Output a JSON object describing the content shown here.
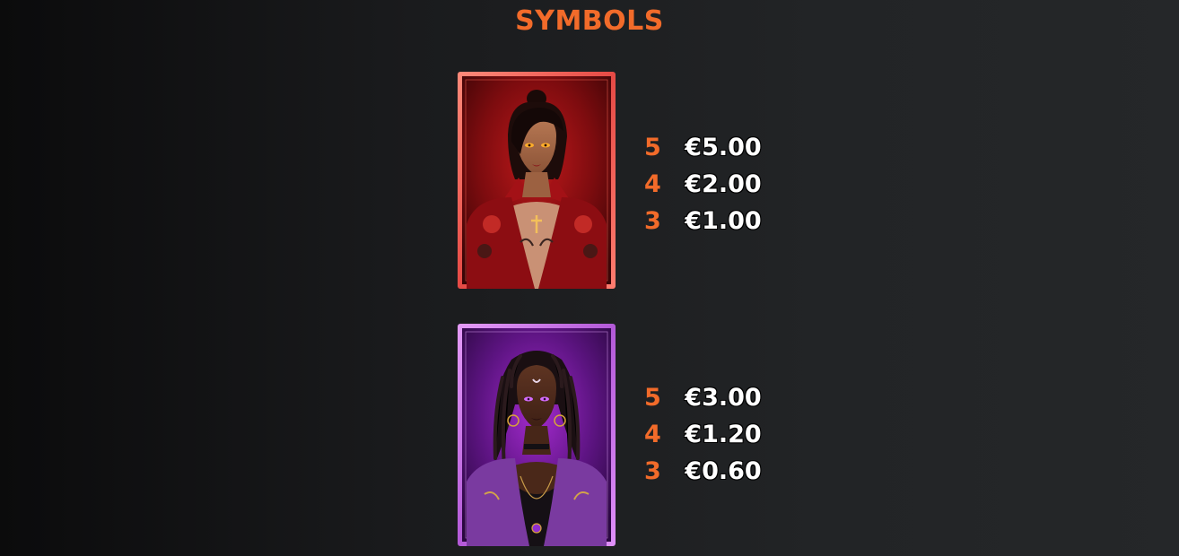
{
  "page": {
    "title": "SYMBOLS",
    "accent_color": "#f26b2a"
  },
  "symbols": [
    {
      "name": "red-vampire-woman",
      "frame_color": "#f2685e",
      "pays": [
        {
          "count": "5",
          "amount": "€5.00"
        },
        {
          "count": "4",
          "amount": "€2.00"
        },
        {
          "count": "3",
          "amount": "€1.00"
        }
      ]
    },
    {
      "name": "purple-dreadlock-woman",
      "frame_color": "#d67bf0",
      "pays": [
        {
          "count": "5",
          "amount": "€3.00"
        },
        {
          "count": "4",
          "amount": "€1.20"
        },
        {
          "count": "3",
          "amount": "€0.60"
        }
      ]
    }
  ]
}
